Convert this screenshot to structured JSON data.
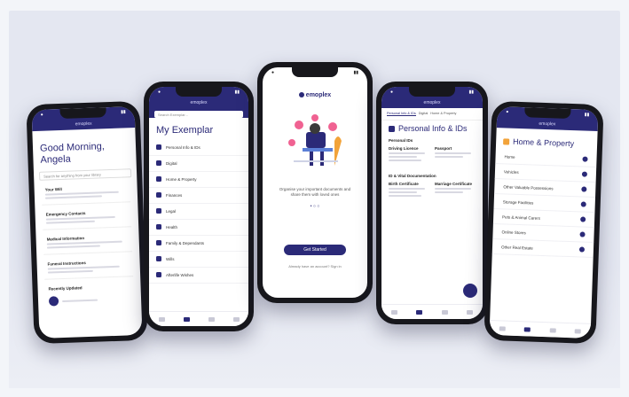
{
  "phones": {
    "p1": {
      "brand": "emoplex",
      "greeting": "Good Morning, Angela",
      "search_placeholder": "Search for anything from your library",
      "cards": [
        {
          "title": "Your Will"
        },
        {
          "title": "Emergency Contacts"
        },
        {
          "title": "Medical Information"
        },
        {
          "title": "Funeral Instructions"
        }
      ],
      "section": "Recently Updated"
    },
    "p2": {
      "brand": "emoplex",
      "title": "My Exemplar",
      "search_placeholder": "Search Exemplar...",
      "items": [
        "Personal Info & IDs",
        "Digital",
        "Home & Property",
        "Finances",
        "Legal",
        "Health",
        "Family & Dependants",
        "Wills",
        "Afterlife Wishes"
      ]
    },
    "p3": {
      "logo": "emoplex",
      "tagline": "Organise your important documents and share them with loved ones",
      "cta": "Get Started",
      "signin": "Already have an account? Sign in"
    },
    "p4": {
      "brand": "emoplex",
      "tabs": [
        "Personal Info & IDs",
        "Digital",
        "Home & Property"
      ],
      "title": "Personal Info & IDs",
      "section1": "Personal IDs",
      "cards1": [
        "Driving Licence",
        "Passport"
      ],
      "section2": "ID & Vital Documentation",
      "cards2": [
        "Birth Certificate",
        "Marriage Certificate"
      ]
    },
    "p5": {
      "brand": "emoplex",
      "title": "Home & Property",
      "items": [
        "Home",
        "Vehicles",
        "Other Valuable Possessions",
        "Storage Facilities",
        "Pets & Animal Carers",
        "Online Stores",
        "Other Real Estate"
      ]
    }
  }
}
